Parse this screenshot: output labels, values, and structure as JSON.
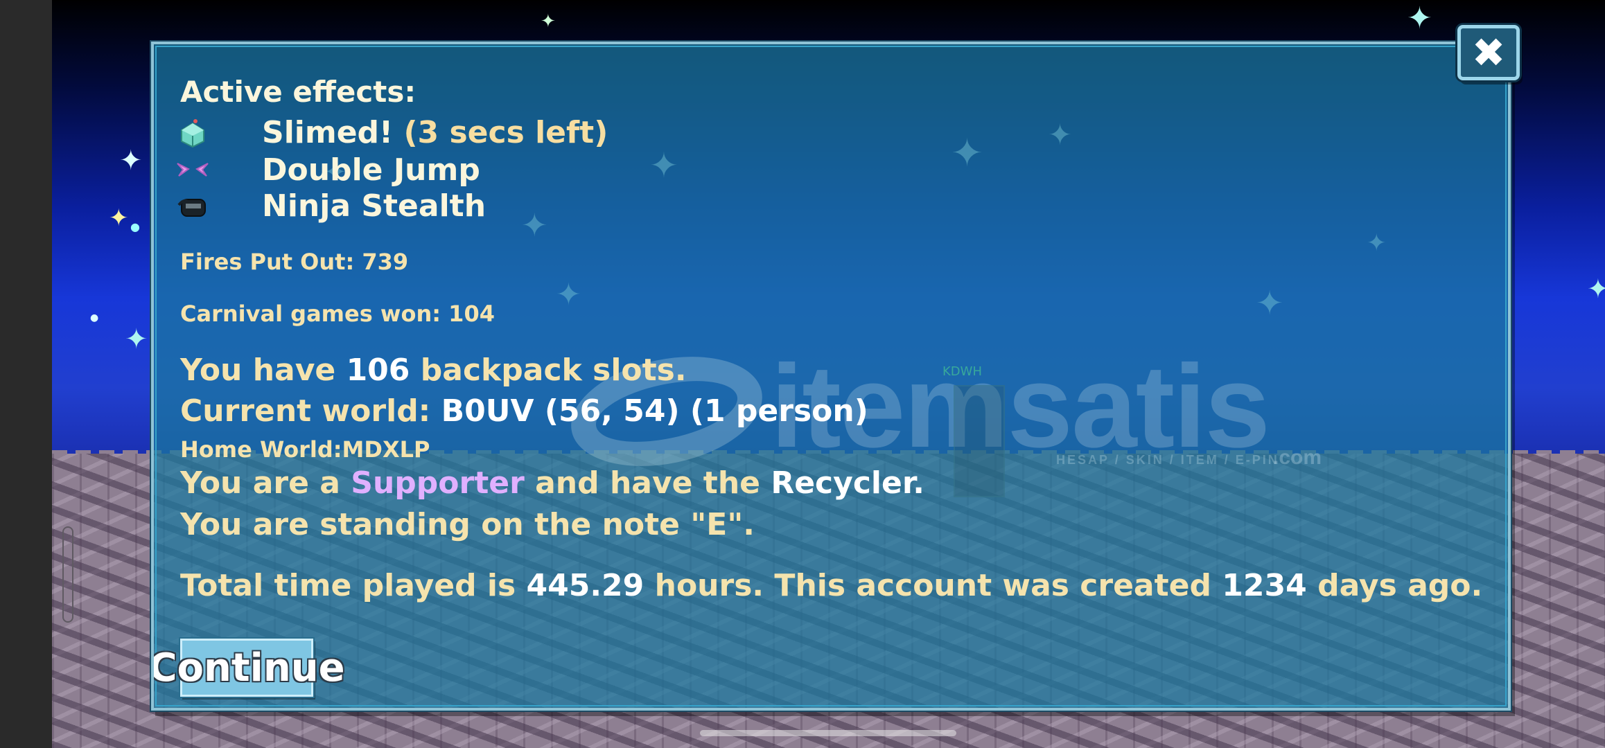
{
  "effects_title": "Active effects:",
  "effects": [
    {
      "icon": "slime-icon",
      "name": "Slimed!",
      "time_left": "(3 secs left)"
    },
    {
      "icon": "double-jump-wings-icon",
      "name": "Double Jump",
      "time_left": ""
    },
    {
      "icon": "ninja-stealth-icon",
      "name": "Ninja Stealth",
      "time_left": ""
    }
  ],
  "stats": {
    "fires_put_out": "Fires Put Out: 739",
    "carnival_games_won": "Carnival games won: 104"
  },
  "backpack": {
    "prefix": "You have",
    "count": "106",
    "suffix": "backpack slots."
  },
  "current_world": {
    "prefix": "Current world:",
    "value": "B0UV (56, 54) (1 person)"
  },
  "home_world": "Home World:MDXLP",
  "supporter": {
    "prefix": "You are a",
    "role": "Supporter",
    "middle": "and have the",
    "item": "Recycler."
  },
  "note": "You are standing on the note \"E\".",
  "playtime": {
    "prefix": "Total time played is",
    "hours": "445.29",
    "middle": "hours.  This account was created",
    "days": "1234",
    "suffix": "days ago."
  },
  "watermark": {
    "text": "itemsatis",
    "sub": "HESAP / SKIN / ITEM / E-PIN",
    "domain": ".com"
  },
  "ghost_player_name": "KDWH",
  "buttons": {
    "continue": "Continue",
    "close": "✖"
  },
  "colors": {
    "panel": "#1a78a0",
    "text_cream": "#f5e3ad",
    "supporter": "#e0b0ff",
    "button": "#7fc6e3"
  }
}
